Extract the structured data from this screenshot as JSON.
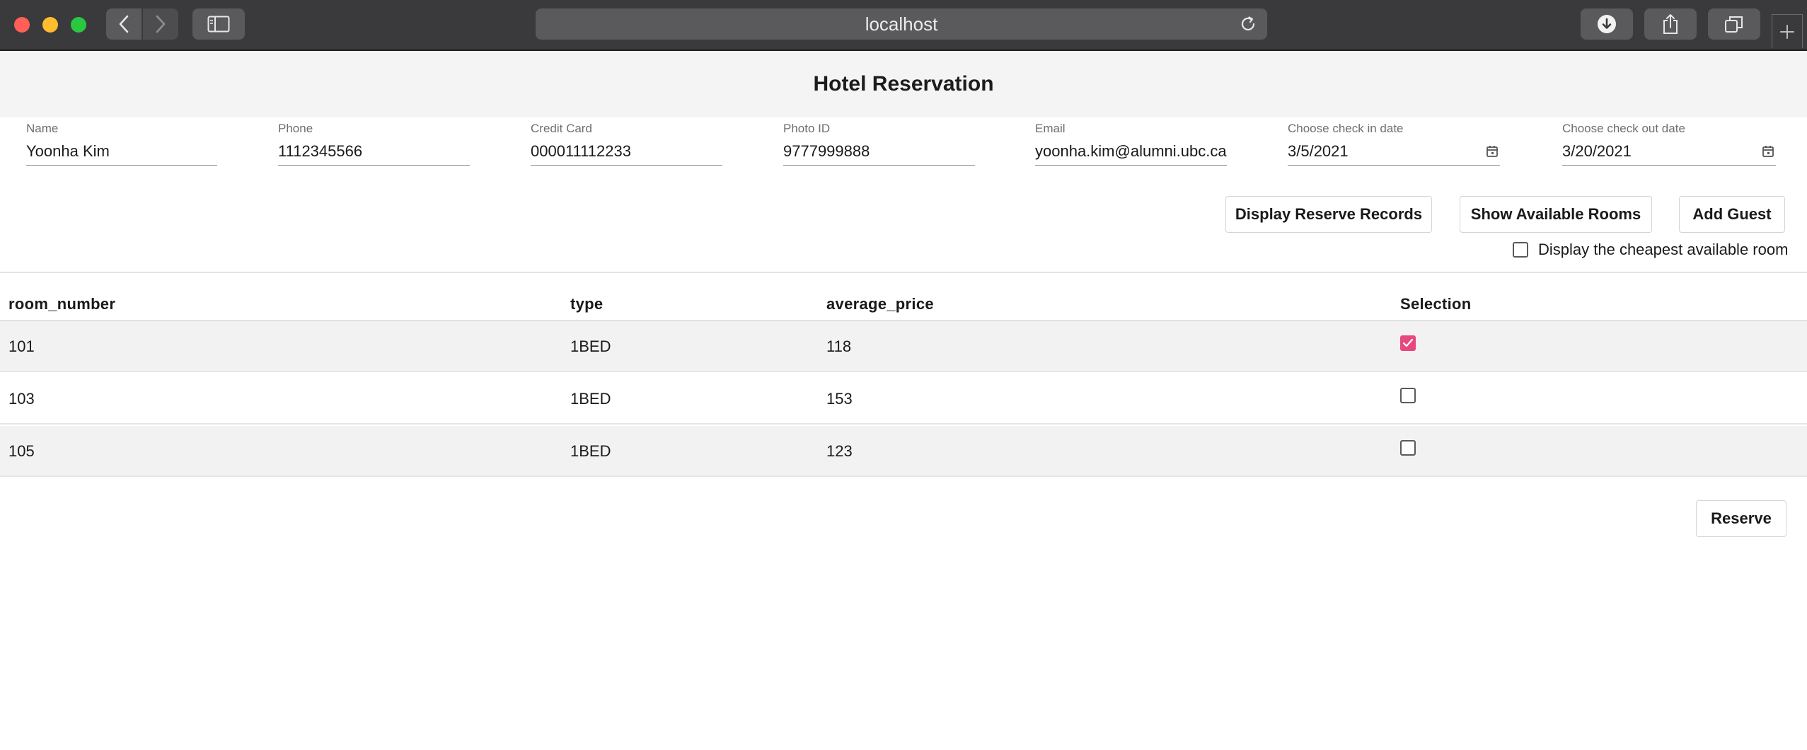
{
  "browser": {
    "url": "localhost"
  },
  "app": {
    "title": "Hotel Reservation"
  },
  "form": {
    "name": {
      "label": "Name",
      "value": "Yoonha Kim"
    },
    "phone": {
      "label": "Phone",
      "value": "1112345566"
    },
    "credit_card": {
      "label": "Credit Card",
      "value": "000011112233"
    },
    "photo_id": {
      "label": "Photo ID",
      "value": "9777999888"
    },
    "email": {
      "label": "Email",
      "value": "yoonha.kim@alumni.ubc.ca"
    },
    "check_in": {
      "label": "Choose check in date",
      "value": "3/5/2021"
    },
    "check_out": {
      "label": "Choose check out date",
      "value": "3/20/2021"
    }
  },
  "actions": {
    "display_records": "Display Reserve Records",
    "show_available": "Show Available Rooms",
    "add_guest": "Add Guest",
    "cheapest_label": "Display the cheapest available room",
    "cheapest_checked": false,
    "reserve": "Reserve"
  },
  "table": {
    "columns": [
      "room_number",
      "type",
      "average_price",
      "Selection"
    ],
    "rows": [
      {
        "room_number": "101",
        "type": "1BED",
        "average_price": "118",
        "selected": true
      },
      {
        "room_number": "103",
        "type": "1BED",
        "average_price": "153",
        "selected": false
      },
      {
        "room_number": "105",
        "type": "1BED",
        "average_price": "123",
        "selected": false
      }
    ]
  },
  "colors": {
    "accent": "#e8477f",
    "chrome": "#3a3a3c",
    "header_band": "#f4f4f4"
  },
  "icons": [
    "back-icon",
    "forward-icon",
    "sidebar-icon",
    "reload-icon",
    "download-icon",
    "share-icon",
    "tabs-icon",
    "plus-icon",
    "calendar-icon",
    "checkmark-icon"
  ]
}
